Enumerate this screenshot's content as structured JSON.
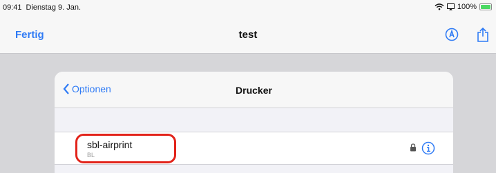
{
  "status_bar": {
    "time": "09:41",
    "date": "Dienstag 9. Jan.",
    "battery": "100%",
    "battery_level": 1.0
  },
  "nav": {
    "done_label": "Fertig",
    "title": "test",
    "icons": [
      "markup-icon",
      "share-icon"
    ]
  },
  "sheet": {
    "back_label": "Optionen",
    "title": "Drucker",
    "printers": [
      {
        "name": "sbl-airprint",
        "location": "BL"
      }
    ]
  },
  "colors": {
    "accent": "#2f7bf5",
    "highlight": "#e2231a",
    "battery": "#4cd964"
  }
}
